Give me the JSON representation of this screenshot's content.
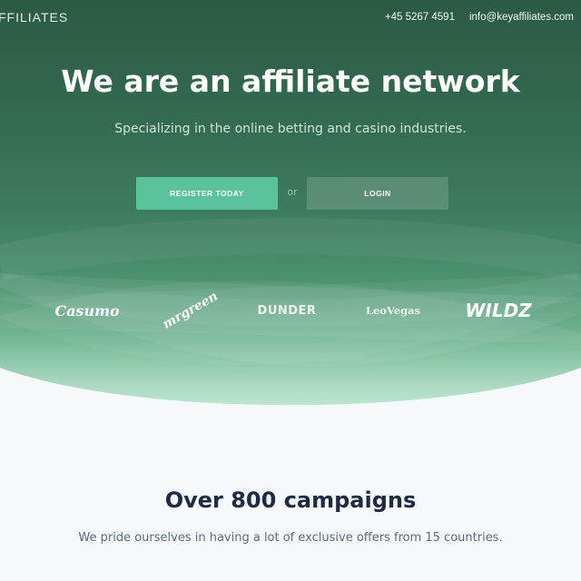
{
  "header": {
    "brand": "FFILIATES",
    "phone": "+45 5267 4591",
    "email": "info@keyaffiliates.com"
  },
  "hero": {
    "headline": "We are an affiliate network",
    "subline": "Specializing in the online betting and casino industries.",
    "register_label": "REGISTER TODAY",
    "or_label": "or",
    "login_label": "LOGIN"
  },
  "partners": {
    "casumo": "Casumo",
    "mrgreen": "mrgreen",
    "dunder": "DUNDER",
    "leovegas": "LeoVegas",
    "wildz": "WILDZ"
  },
  "campaigns": {
    "title": "Over 800 campaigns",
    "subtitle": "We pride ourselves in having a lot of exclusive offers from 15 countries."
  },
  "colors": {
    "hero_dark": "#2c5a45",
    "hero_light": "#c9ecda",
    "accent_button": "#5bc39c",
    "page_bg": "#f6f9fc",
    "title_text": "#1f2a44"
  }
}
